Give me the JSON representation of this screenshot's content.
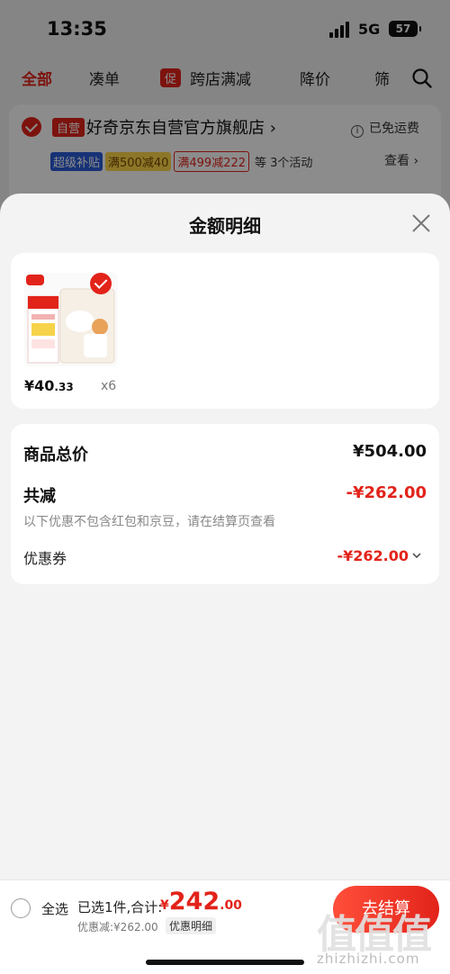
{
  "status_bar": {
    "time": "13:35",
    "network": "5G",
    "battery": "57"
  },
  "cart_tabs": {
    "all": "全部",
    "bundle": "凑单",
    "promo_badge": "促",
    "cross_store": "跨店满减",
    "price_drop": "降价",
    "filter": "筛"
  },
  "store": {
    "self_badge": "自营",
    "name": "好奇京东自营官方旗舰店 ›",
    "free_shipping": "已免运费",
    "promos": [
      "超级补贴",
      "满500减40",
      "满499减222",
      "等 3个活动"
    ],
    "view": "查看 ›"
  },
  "sheet": {
    "title": "金额明细",
    "product": {
      "price_int": "¥40",
      "price_dec": ".33",
      "qty": "x6"
    },
    "summary": {
      "total_label": "商品总价",
      "total_value": "¥504.00",
      "discount_label": "共减",
      "discount_value": "-¥262.00",
      "note": "以下优惠不包含红包和京豆，请在结算页查看",
      "coupon_label": "优惠券",
      "coupon_value": "-¥262.00"
    }
  },
  "bottom_bar": {
    "select_all": "全选",
    "selected": "已选1件,合计:",
    "currency": "¥",
    "total_int": "242",
    "total_dec": ".00",
    "discount_text": "优惠减:¥262.00",
    "detail_button": "优惠明细",
    "checkout": "去结算",
    "watermark": "值值值",
    "watermark_url": "zhizhizhi.com"
  },
  "colors": {
    "accent": "#e2231a",
    "sheet_bg": "#f3f3f3"
  }
}
